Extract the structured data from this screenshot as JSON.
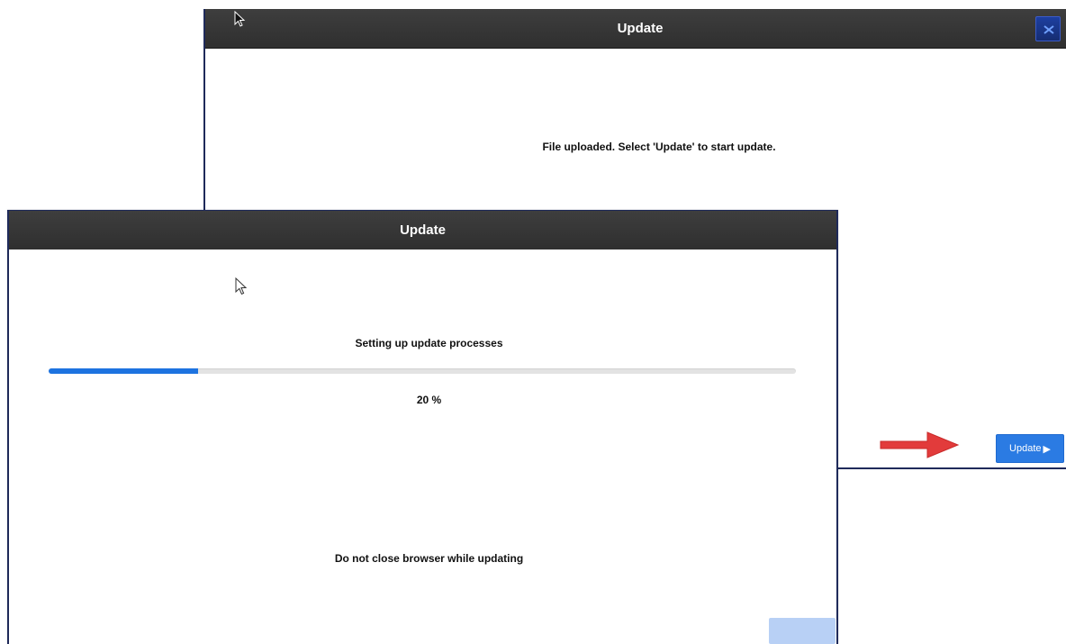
{
  "back_dialog": {
    "title": "Update",
    "close_icon": "close-icon",
    "message": "File uploaded. Select 'Update' to start update.",
    "update_button_label": "Update",
    "update_button_icon": "play-icon"
  },
  "front_dialog": {
    "title": "Update",
    "status": "Setting up update processes",
    "progress_percent": 20,
    "progress_label": "20 %",
    "warning": "Do not close browser while updating"
  },
  "annotation": {
    "arrow_icon": "red-arrow-icon",
    "arrow_color": "#e23b3b"
  },
  "colors": {
    "titlebar": "#333333",
    "accent": "#2b7be3",
    "progress": "#1d73e0",
    "dialog_border": "#1f2a5a"
  }
}
